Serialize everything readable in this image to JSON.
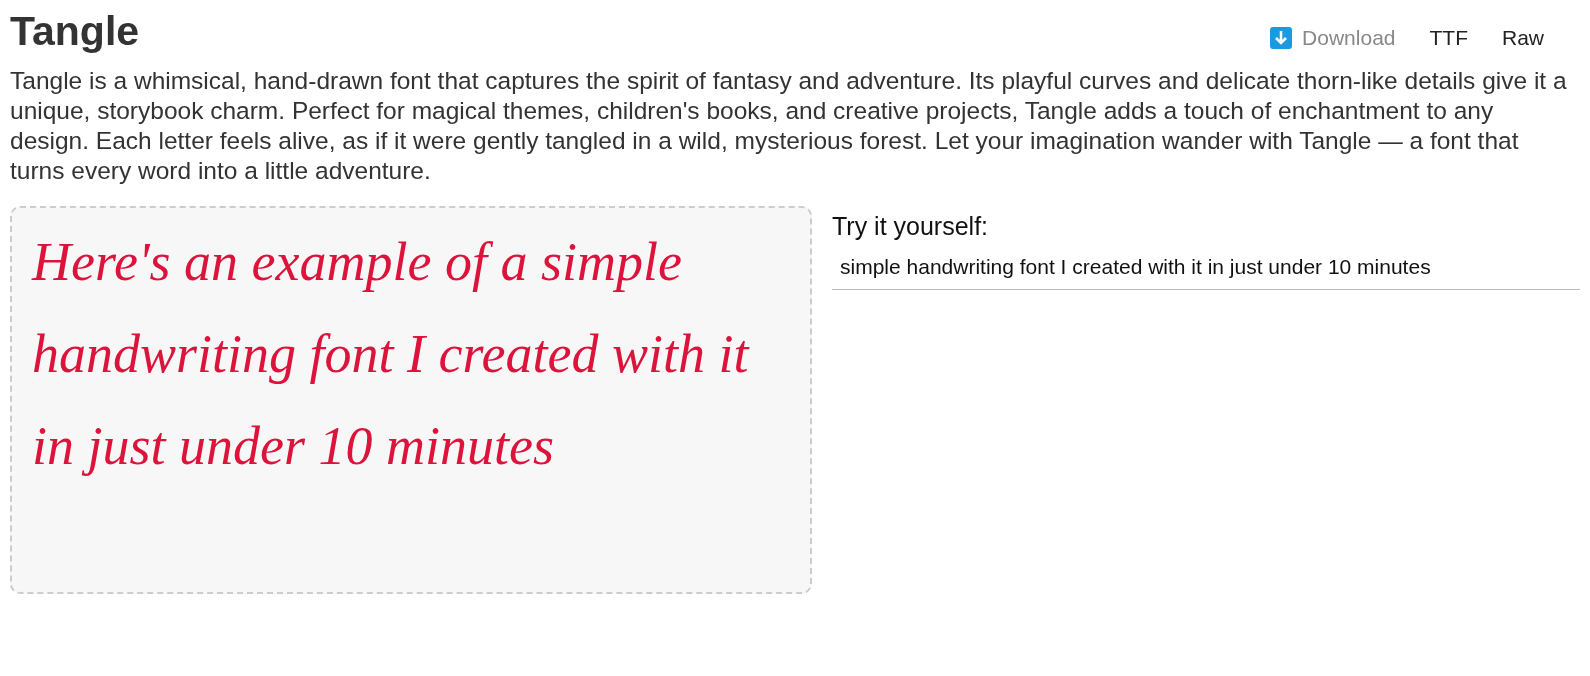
{
  "title": "Tangle",
  "actions": [
    {
      "kind": "download",
      "label": "Download"
    },
    {
      "kind": "link",
      "label": "TTF"
    },
    {
      "kind": "link",
      "label": "Raw"
    }
  ],
  "description": "Tangle is a whimsical, hand-drawn font that captures the spirit of fantasy and adventure. Its playful curves and delicate thorn-like details give it a unique, storybook charm. Perfect for magical themes, children's books, and creative projects, Tangle adds a touch of enchantment to any design. Each letter feels alive, as if it were gently tangled in a wild, mysterious forest. Let your imagination wander with Tangle — a font that turns every word into a little adventure.",
  "preview": {
    "text": "Here's an example of a simple handwriting font I created with it in just under 10 minutes"
  },
  "try_it": {
    "label": "Try it yourself:",
    "value": "simple handwriting font I created with it in just under 10 minutes"
  }
}
